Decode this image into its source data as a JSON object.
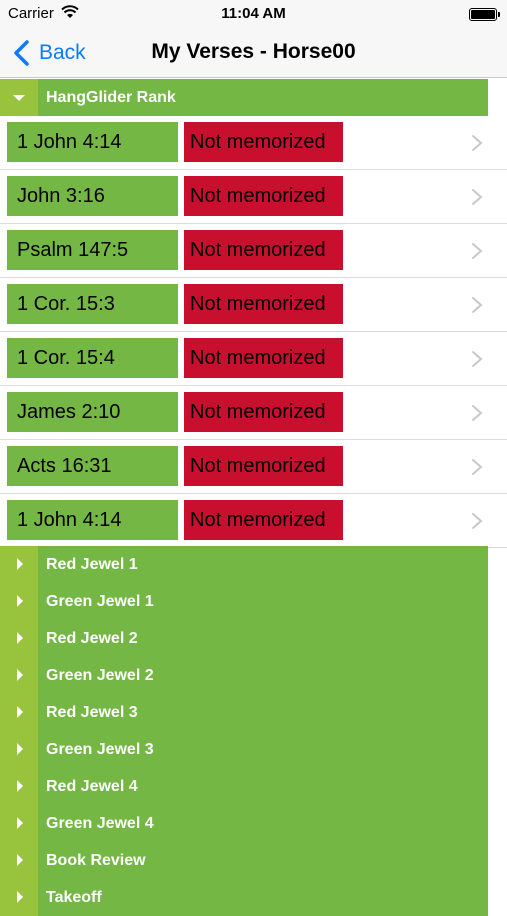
{
  "status_bar": {
    "carrier": "Carrier",
    "time": "11:04 AM"
  },
  "nav": {
    "back_label": "Back",
    "title": "My Verses - Horse00"
  },
  "expanded_section": {
    "title": "HangGlider Rank"
  },
  "verses": [
    {
      "ref": "1 John 4:14",
      "status": "Not memorized"
    },
    {
      "ref": "John 3:16",
      "status": "Not memorized"
    },
    {
      "ref": "Psalm 147:5",
      "status": "Not memorized"
    },
    {
      "ref": "1 Cor. 15:3",
      "status": "Not memorized"
    },
    {
      "ref": "1 Cor. 15:4",
      "status": "Not memorized"
    },
    {
      "ref": "James 2:10",
      "status": "Not memorized"
    },
    {
      "ref": "Acts 16:31",
      "status": "Not memorized"
    },
    {
      "ref": "1 John 4:14",
      "status": "Not memorized"
    }
  ],
  "collapsed_sections": [
    {
      "title": "Red Jewel 1"
    },
    {
      "title": "Green Jewel 1"
    },
    {
      "title": "Red Jewel 2"
    },
    {
      "title": "Green Jewel 2"
    },
    {
      "title": "Red Jewel 3"
    },
    {
      "title": "Green Jewel 3"
    },
    {
      "title": "Red Jewel 4"
    },
    {
      "title": "Green Jewel 4"
    },
    {
      "title": "Book Review"
    },
    {
      "title": "Takeoff"
    }
  ],
  "colors": {
    "accent_blue": "#0a7aff",
    "section_green": "#74b745",
    "section_bar_green": "#97c43c",
    "not_memorized_red": "#c8102e"
  },
  "icons": {
    "back": "chevron-left-icon",
    "expanded": "triangle-down-icon",
    "collapsed": "triangle-right-icon",
    "row": "chevron-right-icon"
  }
}
